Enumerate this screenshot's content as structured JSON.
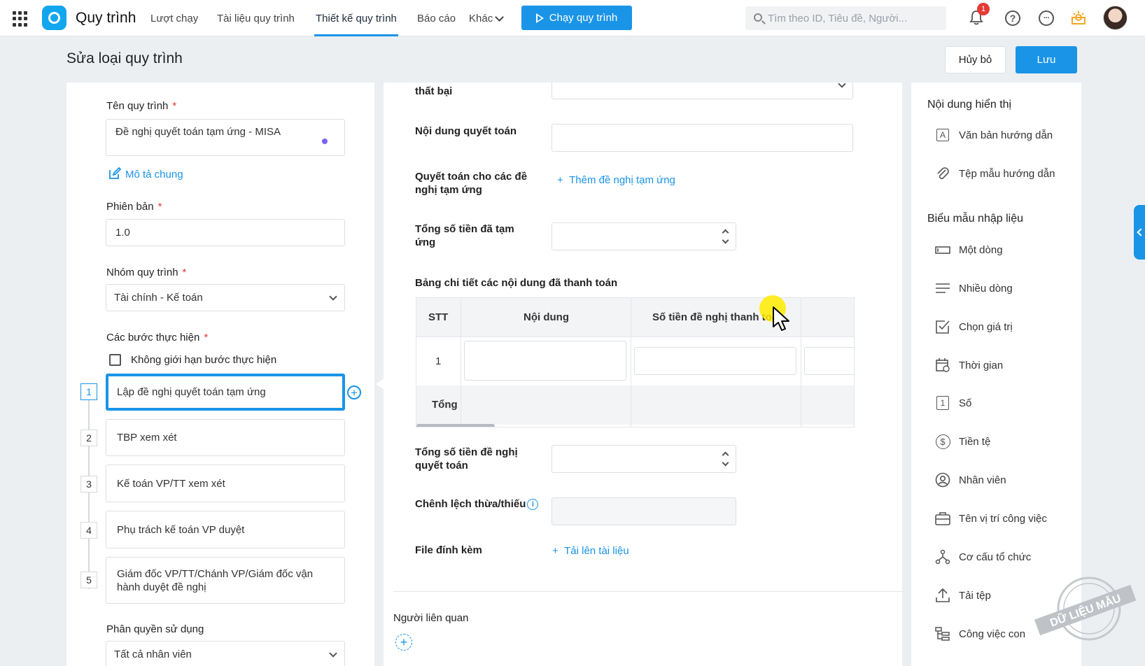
{
  "topnav": {
    "app_title": "Quy trình",
    "items": [
      "Lượt chạy",
      "Tài liệu quy trình",
      "Thiết kế quy trình",
      "Báo cáo",
      "Khác"
    ],
    "active_item": "Thiết kế quy trình",
    "run_button": "Chạy quy trình",
    "search_placeholder": "Tìm theo ID, Tiêu đề, Người...",
    "notification_count": "1",
    "help_symbol": "?",
    "more_symbol": "···"
  },
  "header": {
    "title": "Sửa loại quy trình",
    "cancel": "Hủy bỏ",
    "save": "Lưu"
  },
  "left": {
    "name_label": "Tên quy trình",
    "name_value": "Đề nghị quyết toán tạm ứng  - MISA",
    "description_link": "Mô tả chung",
    "version_label": "Phiên bản",
    "version_value": "1.0",
    "group_label": "Nhóm quy trình",
    "group_value": "Tài chính - Kế toán",
    "steps_label": "Các bước thực hiện",
    "unlimited_steps": "Không giới hạn bước thực hiện",
    "required_mark": "*",
    "steps": [
      {
        "num": "1",
        "label": "Lập đề nghị quyết toán tạm ứng"
      },
      {
        "num": "2",
        "label": "TBP xem xét"
      },
      {
        "num": "3",
        "label": "Kế toán VP/TT xem xét"
      },
      {
        "num": "4",
        "label": "Phụ trách kế toán VP duyệt"
      },
      {
        "num": "5",
        "label": "Giám đốc VP/TT/Chánh VP/Giám đốc vận hành duyệt đề nghị"
      }
    ],
    "permission_label": "Phân quyền sử dụng",
    "permission_value": "Tất cả nhân viên"
  },
  "middle": {
    "partial_label": "thất bại",
    "settlement_content_label": "Nội dung quyết toán",
    "settlement_for_label": "Quyết toán cho các đề nghị tạm ứng",
    "add_advance_link": "Thêm đề nghị tạm ứng",
    "total_advanced_label": "Tổng số tiền đã tạm ứng",
    "table_title": "Bảng chi tiết các nội dung đã thanh toán",
    "table": {
      "headers": [
        "STT",
        "Nội dung",
        "Số tiền đề nghị thanh toán"
      ],
      "rows": [
        {
          "stt": "1"
        }
      ],
      "footer": "Tổng"
    },
    "total_request_label": "Tổng số tiền đề nghị quyết toán",
    "difference_label": "Chênh lệch thừa/thiếu",
    "attachment_label": "File đính kèm",
    "upload_link": "Tải lên tài liệu",
    "related_people_label": "Người liên quan"
  },
  "right": {
    "display_section": "Nội dung hiển thị",
    "display_items": [
      {
        "icon": "text-a-icon",
        "label": "Văn bản hướng dẫn"
      },
      {
        "icon": "paperclip-icon",
        "label": "Tệp mẫu hướng dẫn"
      }
    ],
    "form_section": "Biểu mẫu nhập liệu",
    "form_items": [
      {
        "icon": "single-line-icon",
        "label": "Một dòng"
      },
      {
        "icon": "multi-line-icon",
        "label": "Nhiều dòng"
      },
      {
        "icon": "checkbox-icon",
        "label": "Chọn giá trị"
      },
      {
        "icon": "calendar-icon",
        "label": "Thời gian"
      },
      {
        "icon": "number-icon",
        "label": "Số"
      },
      {
        "icon": "currency-icon",
        "label": "Tiền tệ"
      },
      {
        "icon": "employee-icon",
        "label": "Nhân viên"
      },
      {
        "icon": "briefcase-icon",
        "label": "Tên vị trí công việc"
      },
      {
        "icon": "org-chart-icon",
        "label": "Cơ cấu tổ chức"
      },
      {
        "icon": "upload-icon",
        "label": "Tải tệp"
      },
      {
        "icon": "subtask-icon",
        "label": "Công việc con"
      }
    ]
  },
  "watermark_text": "DỮ LIỆU MẪU",
  "colors": {
    "accent": "#1a94e6",
    "required": "#e53935",
    "background": "#eceff2",
    "cursor_highlight": "#ffeb00"
  }
}
